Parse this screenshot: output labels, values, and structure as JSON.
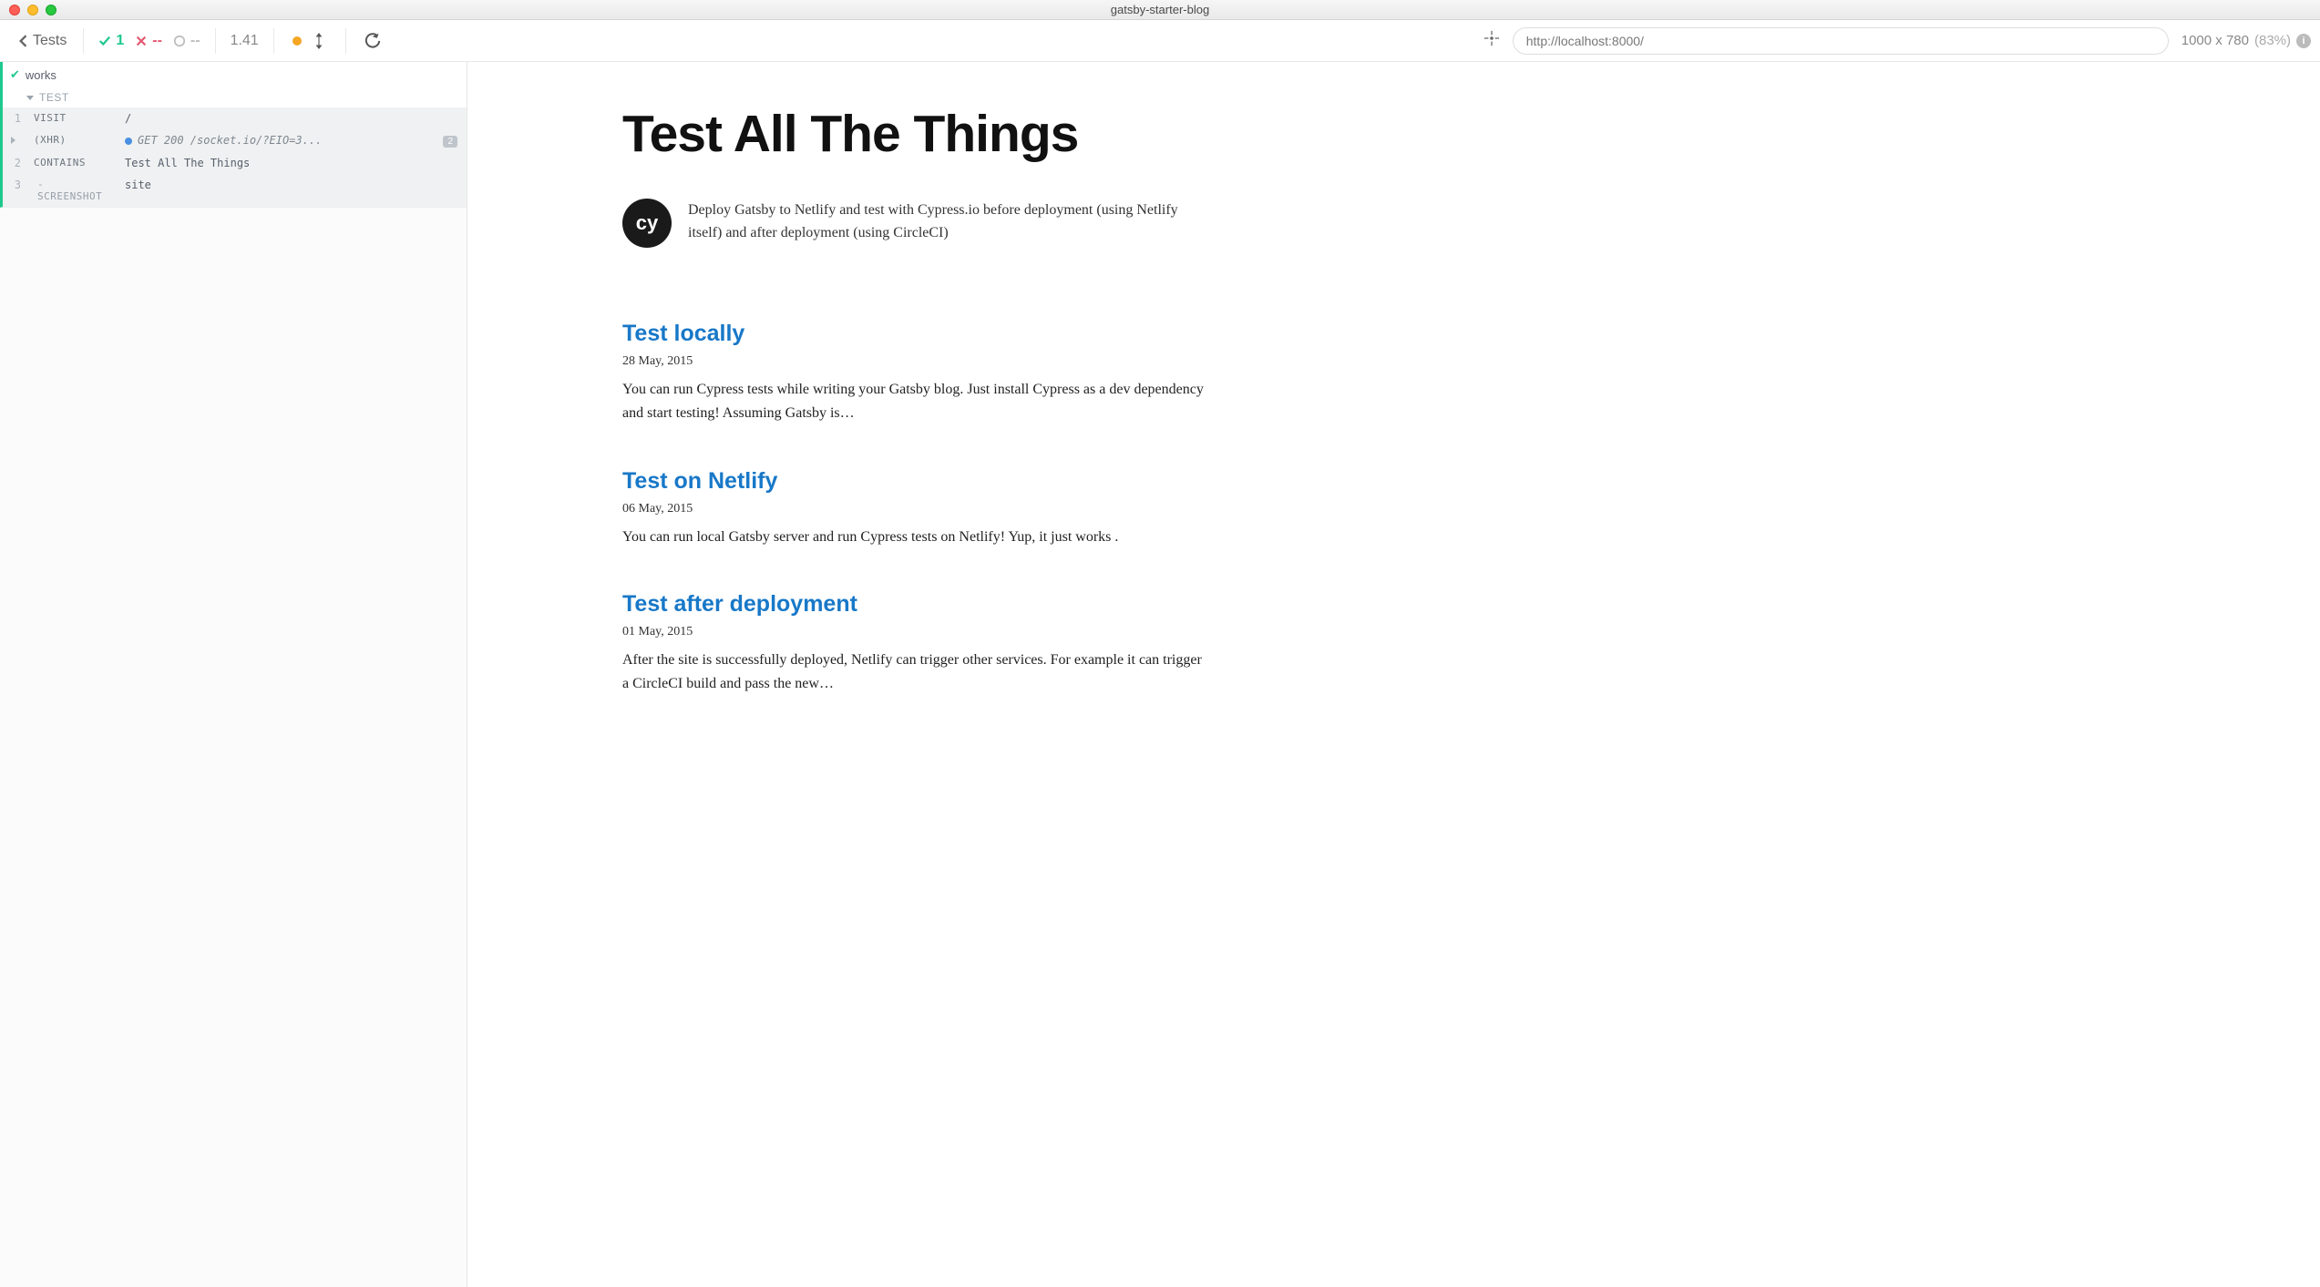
{
  "window": {
    "title": "gatsby-starter-blog"
  },
  "header": {
    "back_label": "Tests",
    "stats": {
      "passed": "1",
      "failed": "--",
      "pending": "--"
    },
    "duration": "1.41",
    "url": "http://localhost:8000/",
    "viewport": {
      "size": "1000 x 780",
      "scale": "(83%)"
    }
  },
  "reporter": {
    "test_name": "works",
    "hook_label": "TEST",
    "commands": [
      {
        "num": "1",
        "name": "VISIT",
        "msg": "/",
        "type": "cmd"
      },
      {
        "num": "",
        "name": "(XHR)",
        "msg": "GET 200 /socket.io/?EIO=3...",
        "badge": "2",
        "type": "xhr"
      },
      {
        "num": "2",
        "name": "CONTAINS",
        "msg": "Test All The Things",
        "type": "cmd"
      },
      {
        "num": "3",
        "name": "- SCREENSHOT",
        "msg": "site",
        "type": "sub"
      }
    ]
  },
  "preview": {
    "blog_title": "Test All The Things",
    "avatar_text": "cy",
    "bio": "Deploy Gatsby to Netlify and test with Cypress.io before deployment (using Netlify itself) and after deployment (using CircleCI)",
    "posts": [
      {
        "title": "Test locally",
        "date": "28 May, 2015",
        "excerpt": "You can run Cypress tests while writing your Gatsby blog. Just install Cypress as a dev dependency and start testing! Assuming Gatsby is…"
      },
      {
        "title": "Test on Netlify",
        "date": "06 May, 2015",
        "excerpt": "You can run local Gatsby server and run Cypress tests on Netlify! Yup, it just works ."
      },
      {
        "title": "Test after deployment",
        "date": "01 May, 2015",
        "excerpt": "After the site is successfully deployed, Netlify can trigger other services. For example it can trigger a CircleCI build and pass the new…"
      }
    ]
  }
}
